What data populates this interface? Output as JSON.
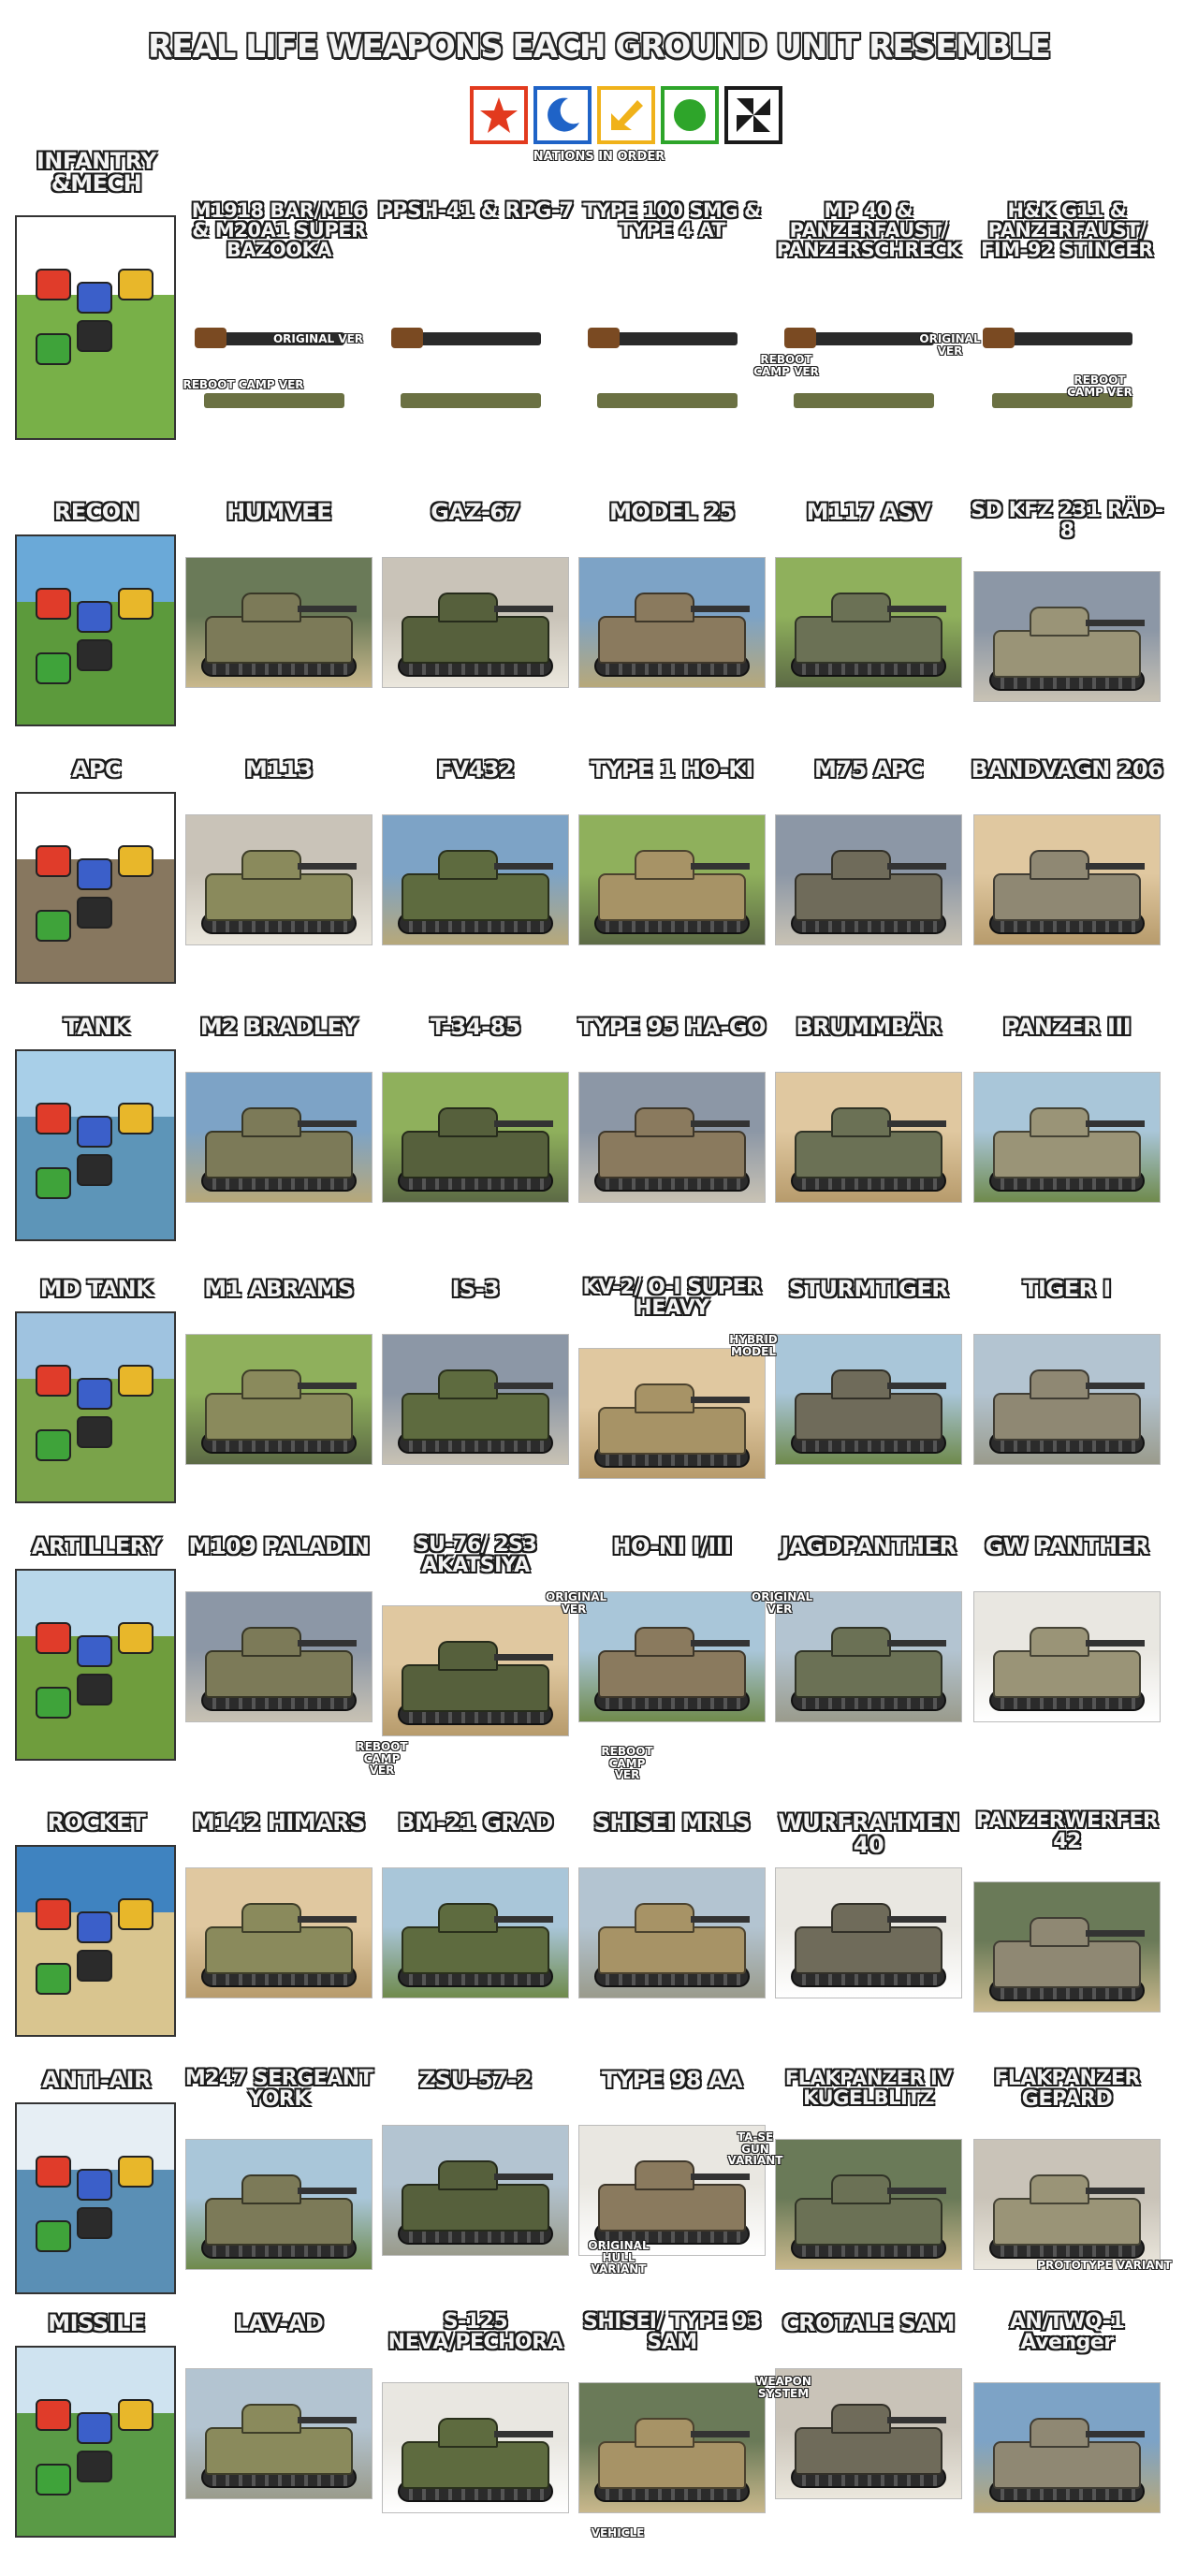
{
  "header": {
    "title": "REAL LIFE WEAPONS EACH GROUND UNIT RESEMBLE",
    "nations_caption": "NATIONS IN ORDER",
    "nations": [
      {
        "name": "star",
        "color": "#e23a1e",
        "icon": "star-icon"
      },
      {
        "name": "moon",
        "color": "#1f63c7",
        "icon": "crescent-moon-icon"
      },
      {
        "name": "arrow",
        "color": "#f0b21a",
        "icon": "arrow-icon"
      },
      {
        "name": "circle",
        "color": "#2ea52a",
        "icon": "circle-icon"
      },
      {
        "name": "black",
        "color": "#1a1a1a",
        "icon": "pinwheel-icon"
      }
    ]
  },
  "rows": [
    {
      "unit": "INFANTRY &MECH",
      "items": [
        "M1918 BAR/M16 & M20A1 SUPER BAZOOKA",
        "PPSH-41 & RPG-7",
        "TYPE 100 SMG & TYPE 4 AT",
        "MP 40 & PANZERFAUST/ PANZERSCHRECK",
        "H&K G11 & PANZERFAUST/ FIM-92 STINGER"
      ]
    },
    {
      "unit": "RECON",
      "items": [
        "HUMVEE",
        "GAZ-67",
        "MODEL 25",
        "M117 ASV",
        "SD KFZ 231 RÄD-8"
      ]
    },
    {
      "unit": "APC",
      "items": [
        "M113",
        "FV432",
        "TYPE 1 HO-KI",
        "M75 APC",
        "BANDVAGN 206"
      ]
    },
    {
      "unit": "TANK",
      "items": [
        "M2 BRADLEY",
        "T-34-85",
        "TYPE 95 HA-GO",
        "BRUMMBÄR",
        "PANZER III"
      ]
    },
    {
      "unit": "MD TANK",
      "items": [
        "M1 ABRAMS",
        "IS-3",
        "KV-2/ O-I SUPER HEAVY",
        "STURMTIGER",
        "TIGER I"
      ]
    },
    {
      "unit": "ARTILLERY",
      "items": [
        "M109 PALADIN",
        "SU-76/ 2S3 AKATSIYA",
        "HO-NI I/III",
        "JAGDPANTHER",
        "GW PANTHER"
      ]
    },
    {
      "unit": "ROCKET",
      "items": [
        "M142 HIMARS",
        "BM-21 GRAD",
        "SHISEI MRLS",
        "WURFRAHMEN 40",
        "PANZERWERFER 42"
      ]
    },
    {
      "unit": "ANTI-AIR",
      "items": [
        "M247 SERGEANT YORK",
        "ZSU-57-2",
        "TYPE 98 AA",
        "FLAKPANZER IV KUGELBLITZ",
        "FLAKPANZER GEPARD"
      ]
    },
    {
      "unit": "MISSILE",
      "items": [
        "LAV-AD",
        "S-125 NEVA/PECHORA",
        "SHISEI/ TYPE 93 SAM",
        "CROTALE SAM",
        "AN/TWQ-1 Avenger"
      ]
    }
  ],
  "captions": {
    "original_ver": "ORIGINAL VER",
    "reboot_camp_ver": "REBOOT CAMP VER",
    "reboot_camp_ver_short": "REBOOT CAMP VER",
    "hybrid_model": "HYBRID MODEL",
    "ta_se_gun_variant": "TA-SE GUN VARIANT",
    "original_hull_variant": "ORIGINAL HULL VARIANT",
    "prototype_variant": "PROTOTYPE VARIANT",
    "weapon_system": "WEAPON SYSTEM",
    "vehicle": "VEHICLE"
  },
  "palette": {
    "red": "#e03c2a",
    "blue": "#3b5fc9",
    "yellow": "#e8b72a",
    "green": "#3fa33a",
    "black": "#2b2b2b"
  }
}
